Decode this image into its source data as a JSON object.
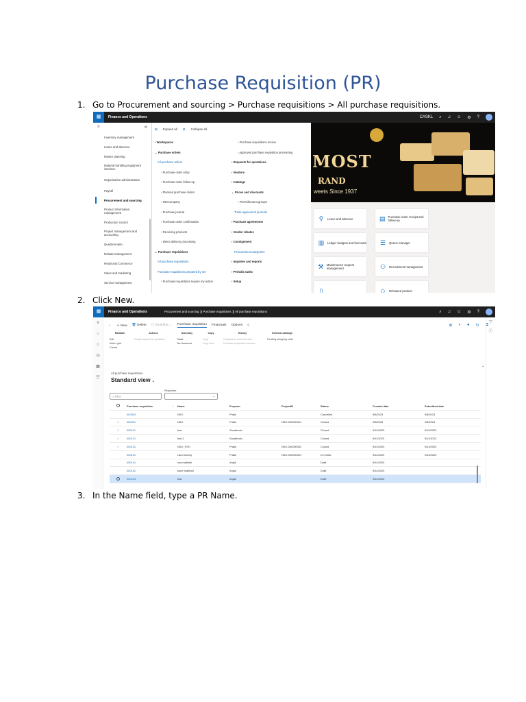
{
  "document": {
    "title": "Purchase Requisition (PR)",
    "steps": [
      {
        "num": "1.",
        "text": "Go to Procurement and sourcing > Purchase requisitions > All purchase requisitions."
      },
      {
        "num": "2.",
        "text": "Click New."
      },
      {
        "num": "3.",
        "text": "In the Name field, type a PR Name."
      }
    ]
  },
  "shot1": {
    "app_name": "Finance and Operations",
    "company": "CASKL",
    "nav_items": [
      "Inventory management",
      "Lease and absence",
      "Master planning",
      "Material handling equipment interface",
      "Organization administration",
      "Payroll",
      "Procurement and sourcing",
      "Product information management",
      "Production control",
      "Project management and accounting",
      "Questionnaire",
      "Rebate management",
      "Retail and Commerce",
      "Sales and marketing",
      "Service management"
    ],
    "active_nav": "Procurement and sourcing",
    "flyout": {
      "expand_all": "Expand all",
      "collapse_all": "Collapse all",
      "col1": [
        {
          "t": "Workspaces",
          "k": "head"
        },
        {
          "t": "Purchase orders",
          "k": "head"
        },
        {
          "t": "All purchase orders",
          "k": "link"
        },
        {
          "t": "Purchase order entry",
          "k": "ind"
        },
        {
          "t": "Purchase order follow-up",
          "k": "ind"
        },
        {
          "t": "Planned purchase orders",
          "k": "ind"
        },
        {
          "t": "Intercompany",
          "k": "ind"
        },
        {
          "t": "Purchase journal",
          "k": "ind"
        },
        {
          "t": "Purchase order confirmation",
          "k": "ind"
        },
        {
          "t": "Receiving products",
          "k": "ind"
        },
        {
          "t": "Direct delivery processing",
          "k": "ind"
        },
        {
          "t": "Purchase requisitions",
          "k": "head"
        },
        {
          "t": "All purchase requisitions",
          "k": "link"
        },
        {
          "t": "Purchase requisitions prepared by me",
          "k": "link"
        },
        {
          "t": "Purchase requisitions require my action",
          "k": "ind"
        }
      ],
      "col2": [
        {
          "t": "Purchase requisitions review",
          "k": "ind"
        },
        {
          "t": "Approved purchase requisition processing",
          "k": "ind"
        },
        {
          "t": "Requests for quotations",
          "k": "head"
        },
        {
          "t": "Vendors",
          "k": "head"
        },
        {
          "t": "Catalogs",
          "k": "head"
        },
        {
          "t": "Prices and discounts",
          "k": "head"
        },
        {
          "t": "Price/discount groups",
          "k": "ind"
        },
        {
          "t": "Trade agreement journals",
          "k": "link"
        },
        {
          "t": "Purchase agreements",
          "k": "head"
        },
        {
          "t": "Vendor rebates",
          "k": "head"
        },
        {
          "t": "Consignment",
          "k": "head"
        },
        {
          "t": "Procurement categories",
          "k": "link"
        },
        {
          "t": "Inquiries and reports",
          "k": "head"
        },
        {
          "t": "Periodic tasks",
          "k": "head"
        },
        {
          "t": "Setup",
          "k": "head"
        }
      ]
    },
    "banner": {
      "big": "MOST",
      "brand": "RAND",
      "since": "weets Since 1937"
    },
    "tiles": [
      {
        "icon": "person-icon",
        "label": "Leave and absence"
      },
      {
        "icon": "receipt-icon",
        "label": "Purchase order receipt and follow-up"
      },
      {
        "icon": "ledger-icon",
        "label": "Ledger budgets and forecasts"
      },
      {
        "icon": "queue-icon",
        "label": "Queue manager"
      },
      {
        "icon": "wrench-icon",
        "label": "Maintenance request management"
      },
      {
        "icon": "recruit-icon",
        "label": "Recruitment management"
      },
      {
        "icon": "doc-icon",
        "label": ""
      },
      {
        "icon": "cart-icon",
        "label": "Released product"
      }
    ]
  },
  "shot2": {
    "app_name": "Finance and Operations",
    "breadcrumb": [
      "Procurement and sourcing",
      "Purchase requisitions",
      "All purchase requisitions"
    ],
    "actions": {
      "new": "New",
      "delete": "Delete",
      "workflow": "Workflow",
      "tab_pr": "Purchase requisition",
      "tab_fin": "Financials",
      "tab_opt": "Options"
    },
    "ribbon_groups": [
      {
        "head": "Maintain",
        "items": [
          "Edit",
          "Add in grid",
          "Cancel"
        ]
      },
      {
        "head": "Actions",
        "items": [
          "Create request for quotation"
        ]
      },
      {
        "head": "Summary",
        "items": [
          "Totals",
          "Tax document"
        ]
      },
      {
        "head": "Copy",
        "items": [
          "Copy",
          "Copy lines"
        ]
      },
      {
        "head": "History",
        "items": [
          "Compare to recent version",
          "Purchase requisition versions"
        ]
      },
      {
        "head": "External catalogs",
        "items": [
          "Pending shopping carts"
        ]
      }
    ],
    "section_label": "All purchase requisitions",
    "view_name": "Standard view",
    "filter_placeholder": "Filter",
    "requester_label": "Requester",
    "columns": [
      "Purchase requisition",
      "Name",
      "Preparer",
      "ProjectID",
      "Status",
      "Created date",
      "Submitted date"
    ],
    "rows": [
      {
        "check": "",
        "id": "000003",
        "name": "NSO",
        "preparer": "Pratik",
        "project": "",
        "status": "Cancelled",
        "created": "9/8/2023",
        "submitted": "9/8/2023"
      },
      {
        "check": "✓",
        "id": "000091",
        "name": "NSO",
        "preparer": "Pratik",
        "project": "NSO-000000001",
        "status": "Closed",
        "created": "9/8/2023",
        "submitted": "9/8/2023"
      },
      {
        "check": "✓",
        "id": "000110",
        "name": "test",
        "preparer": "Sanathndu",
        "project": "",
        "status": "Closed",
        "created": "9/10/2023",
        "submitted": "9/10/2023"
      },
      {
        "check": "✓",
        "id": "000113",
        "name": "test 2",
        "preparer": "Sanathndu",
        "project": "",
        "status": "Closed",
        "created": "9/11/2023",
        "submitted": "9/11/2023"
      },
      {
        "check": "✓",
        "id": "000122",
        "name": "NSO_HYD",
        "preparer": "Pratik",
        "project": "NSO-000000002",
        "status": "Closed",
        "created": "9/13/2023",
        "submitted": "9/13/2023"
      },
      {
        "check": "",
        "id": "000131",
        "name": "Land survey",
        "preparer": "Pratik",
        "project": "NSO-000000001",
        "status": "In review",
        "created": "9/14/2023",
        "submitted": "9/14/2023"
      },
      {
        "check": "",
        "id": "000141",
        "name": "raw material",
        "preparer": "Anjali",
        "project": "",
        "status": "Draft",
        "created": "9/14/2023",
        "submitted": ""
      },
      {
        "check": "",
        "id": "000142",
        "name": "store material",
        "preparer": "Anjali",
        "project": "",
        "status": "Draft",
        "created": "9/14/2023",
        "submitted": ""
      },
      {
        "check": "",
        "id": "000143",
        "name": "test",
        "preparer": "Anjali",
        "project": "",
        "status": "Draft",
        "created": "9/14/2023",
        "submitted": ""
      }
    ],
    "selected_row": 8
  },
  "colors": {
    "title": "#2f5597",
    "accent": "#0f6cbd",
    "topbar": "#1f1f1f"
  }
}
